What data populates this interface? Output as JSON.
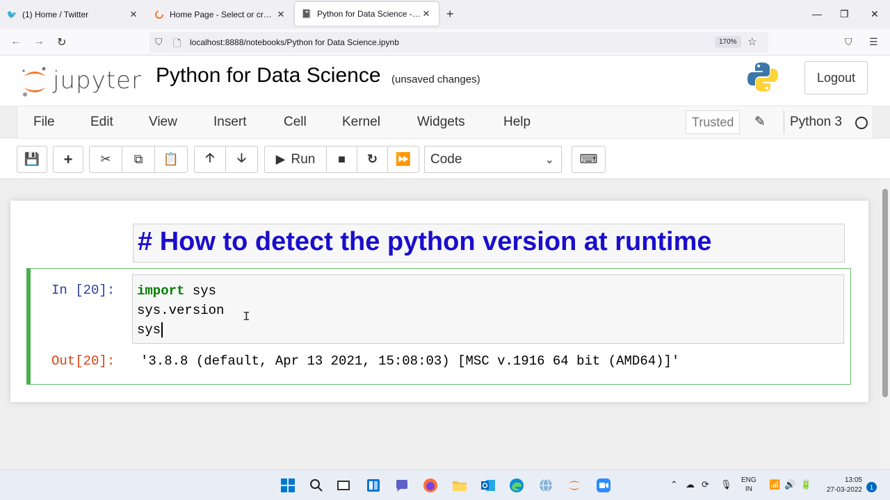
{
  "browser": {
    "tabs": [
      {
        "title": "(1) Home / Twitter",
        "icon": "twitter-bird-icon"
      },
      {
        "title": "Home Page - Select or create a notebook",
        "icon": "jupyter-spinner-icon"
      },
      {
        "title": "Python for Data Science - Jupyter Notebook",
        "icon": "notebook-icon"
      }
    ],
    "url": "localhost:8888/notebooks/Python for Data Science.ipynb",
    "zoom": "170%"
  },
  "jupyter": {
    "logo_text": "jupyter",
    "notebook_title": "Python for Data Science",
    "save_status": "(unsaved changes)",
    "logout_label": "Logout",
    "menu": [
      "File",
      "Edit",
      "View",
      "Insert",
      "Cell",
      "Kernel",
      "Widgets",
      "Help"
    ],
    "trusted_label": "Trusted",
    "kernel_name": "Python 3",
    "toolbar": {
      "run_label": "Run",
      "cell_type": "Code"
    }
  },
  "cells": {
    "markdown": "# How to detect the python version at runtime",
    "code": {
      "prompt_in": "In [20]:",
      "line1_keyword": "import",
      "line1_rest": " sys",
      "line2": "sys.version",
      "line3": "sys",
      "prompt_out": "Out[20]:",
      "output": "'3.8.8 (default, Apr 13 2021, 15:08:03) [MSC v.1916 64 bit (AMD64)]'"
    }
  },
  "taskbar": {
    "lang_line1": "ENG",
    "lang_line2": "IN",
    "time": "13:05",
    "date": "27-03-2022",
    "notification_count": "1"
  },
  "colors": {
    "markdown_heading": "#1a0dcc",
    "selected_cell_border": "#4caf50",
    "keyword": "#008000",
    "in_prompt": "#303f9f",
    "out_prompt": "#d84315"
  }
}
